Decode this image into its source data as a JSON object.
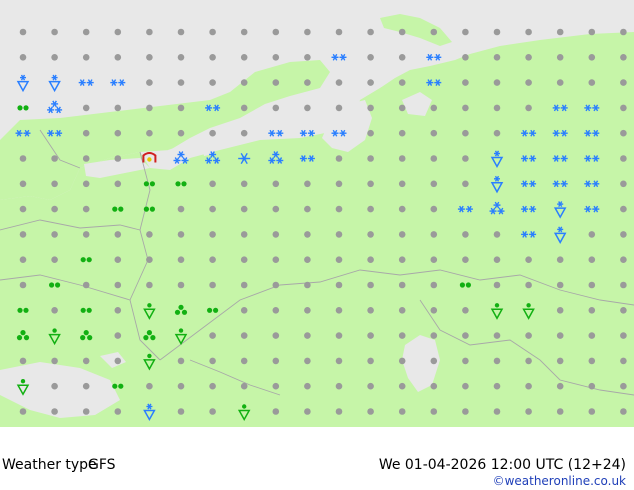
{
  "map": {
    "colors": {
      "sea": "#e8e8e8",
      "land": "#c6f5a8",
      "border": "#a8a8a8",
      "dot": "#9a9a9a",
      "snow": "#2a7fff",
      "rain": "#12b012",
      "mixed": "#d02020",
      "mixed2": "#e8c800"
    },
    "symbols": [
      {
        "col": 0,
        "row": 2,
        "kind": "snow-shower"
      },
      {
        "col": 1,
        "row": 2,
        "kind": "snow-shower"
      },
      {
        "col": 2,
        "row": 2,
        "kind": "snow"
      },
      {
        "col": 3,
        "row": 2,
        "kind": "snow"
      },
      {
        "col": 0,
        "row": 3,
        "kind": "rain-drops"
      },
      {
        "col": 1,
        "row": 3,
        "kind": "snow-heavy"
      },
      {
        "col": 0,
        "row": 4,
        "kind": "snow"
      },
      {
        "col": 1,
        "row": 4,
        "kind": "snow"
      },
      {
        "col": 10,
        "row": 1,
        "kind": "snow"
      },
      {
        "col": 13,
        "row": 1,
        "kind": "snow"
      },
      {
        "col": 13,
        "row": 2,
        "kind": "snow"
      },
      {
        "col": 6,
        "row": 3,
        "kind": "snow"
      },
      {
        "col": 8,
        "row": 4,
        "kind": "snow"
      },
      {
        "col": 9,
        "row": 4,
        "kind": "snow"
      },
      {
        "col": 10,
        "row": 4,
        "kind": "snow"
      },
      {
        "col": 17,
        "row": 3,
        "kind": "snow"
      },
      {
        "col": 18,
        "row": 3,
        "kind": "snow"
      },
      {
        "col": 16,
        "row": 4,
        "kind": "snow"
      },
      {
        "col": 17,
        "row": 4,
        "kind": "snow"
      },
      {
        "col": 18,
        "row": 4,
        "kind": "snow"
      },
      {
        "col": 4,
        "row": 5,
        "kind": "mixed"
      },
      {
        "col": 5,
        "row": 5,
        "kind": "snow-heavy"
      },
      {
        "col": 6,
        "row": 5,
        "kind": "snow-heavy"
      },
      {
        "col": 7,
        "row": 5,
        "kind": "snow-big"
      },
      {
        "col": 8,
        "row": 5,
        "kind": "snow-heavy"
      },
      {
        "col": 9,
        "row": 5,
        "kind": "snow"
      },
      {
        "col": 15,
        "row": 5,
        "kind": "snow-shower"
      },
      {
        "col": 16,
        "row": 5,
        "kind": "snow"
      },
      {
        "col": 17,
        "row": 5,
        "kind": "snow"
      },
      {
        "col": 18,
        "row": 5,
        "kind": "snow"
      },
      {
        "col": 4,
        "row": 6,
        "kind": "rain-drops"
      },
      {
        "col": 5,
        "row": 6,
        "kind": "rain-drops"
      },
      {
        "col": 15,
        "row": 6,
        "kind": "snow-shower"
      },
      {
        "col": 16,
        "row": 6,
        "kind": "snow"
      },
      {
        "col": 17,
        "row": 6,
        "kind": "snow"
      },
      {
        "col": 18,
        "row": 6,
        "kind": "snow"
      },
      {
        "col": 3,
        "row": 7,
        "kind": "rain-drops"
      },
      {
        "col": 4,
        "row": 7,
        "kind": "rain-drops"
      },
      {
        "col": 14,
        "row": 7,
        "kind": "snow"
      },
      {
        "col": 15,
        "row": 7,
        "kind": "snow-heavy"
      },
      {
        "col": 16,
        "row": 7,
        "kind": "snow"
      },
      {
        "col": 17,
        "row": 7,
        "kind": "snow-shower"
      },
      {
        "col": 18,
        "row": 7,
        "kind": "snow"
      },
      {
        "col": 16,
        "row": 8,
        "kind": "snow"
      },
      {
        "col": 17,
        "row": 8,
        "kind": "snow-shower"
      },
      {
        "col": 2,
        "row": 9,
        "kind": "rain-drops"
      },
      {
        "col": 1,
        "row": 10,
        "kind": "rain-drops"
      },
      {
        "col": 14,
        "row": 10,
        "kind": "rain-drops"
      },
      {
        "col": 0,
        "row": 11,
        "kind": "rain-drops"
      },
      {
        "col": 2,
        "row": 11,
        "kind": "rain-drops"
      },
      {
        "col": 4,
        "row": 11,
        "kind": "rain-shower"
      },
      {
        "col": 5,
        "row": 11,
        "kind": "rain-heavy"
      },
      {
        "col": 6,
        "row": 11,
        "kind": "rain-drops"
      },
      {
        "col": 15,
        "row": 11,
        "kind": "rain-shower"
      },
      {
        "col": 16,
        "row": 11,
        "kind": "rain-shower"
      },
      {
        "col": 0,
        "row": 12,
        "kind": "rain-heavy"
      },
      {
        "col": 1,
        "row": 12,
        "kind": "rain-shower"
      },
      {
        "col": 2,
        "row": 12,
        "kind": "rain-heavy"
      },
      {
        "col": 4,
        "row": 12,
        "kind": "rain-heavy"
      },
      {
        "col": 5,
        "row": 12,
        "kind": "rain-shower"
      },
      {
        "col": 4,
        "row": 13,
        "kind": "rain-shower"
      },
      {
        "col": 0,
        "row": 14,
        "kind": "rain-shower"
      },
      {
        "col": 3,
        "row": 14,
        "kind": "rain-drops"
      },
      {
        "col": 4,
        "row": 15,
        "kind": "snow-shower"
      },
      {
        "col": 7,
        "row": 15,
        "kind": "rain-shower"
      }
    ]
  },
  "footer": {
    "title": "Weather type",
    "model": "GFS",
    "valid": "We 01-04-2026 12:00 UTC (12+24)",
    "credit": "©weatheronline.co.uk"
  }
}
